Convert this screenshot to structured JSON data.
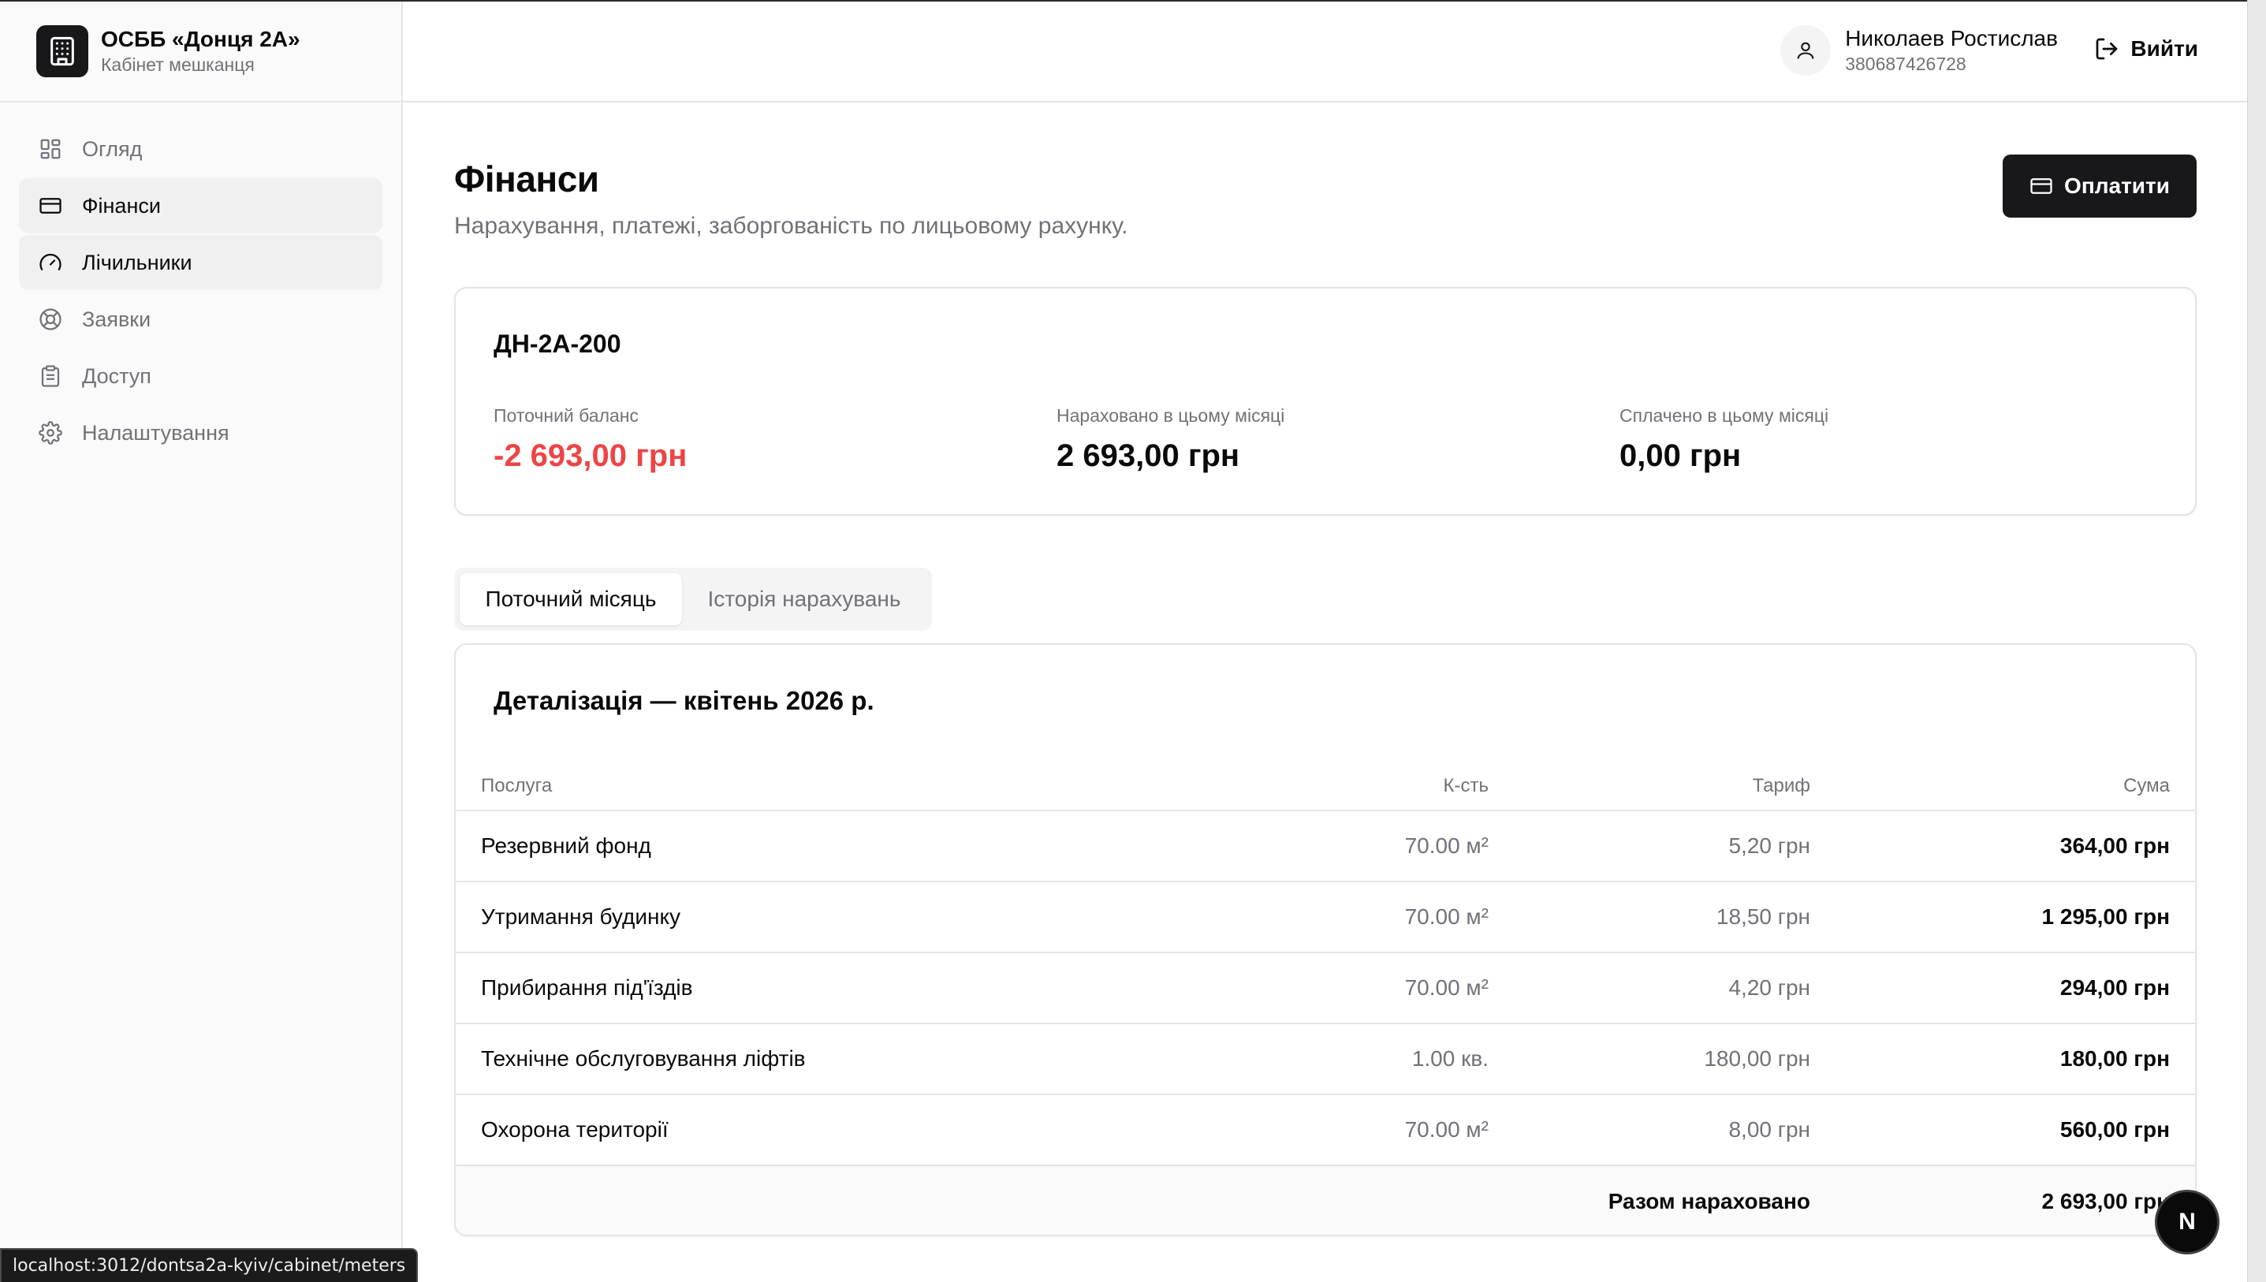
{
  "brand": {
    "title": "ОСББ «Донця 2А»",
    "subtitle": "Кабінет мешканця",
    "icon": "building-icon"
  },
  "sidebar": {
    "items": [
      {
        "label": "Огляд",
        "icon": "dashboard-icon",
        "active": false
      },
      {
        "label": "Фінанси",
        "icon": "credit-card-icon",
        "active": true
      },
      {
        "label": "Лічильники",
        "icon": "gauge-icon",
        "active": false,
        "hover": true
      },
      {
        "label": "Заявки",
        "icon": "lifebuoy-icon",
        "active": false
      },
      {
        "label": "Доступ",
        "icon": "clipboard-icon",
        "active": false
      },
      {
        "label": "Налаштування",
        "icon": "gear-icon",
        "active": false
      }
    ]
  },
  "header": {
    "user_name": "Николаев Ростислав",
    "user_phone": "380687426728",
    "logout_label": "Вийти"
  },
  "page": {
    "title": "Фінанси",
    "subtitle": "Нарахування, платежі, заборгованість по лицьовому рахунку.",
    "pay_label": "Оплатити"
  },
  "summary": {
    "account": "ДН-2А-200",
    "balance_label": "Поточний баланс",
    "balance_value": "-2 693,00 грн",
    "charged_label": "Нараховано в цьому місяці",
    "charged_value": "2 693,00 грн",
    "paid_label": "Сплачено в цьому місяці",
    "paid_value": "0,00 грн",
    "negative_color": "#ef4444"
  },
  "tabs": [
    {
      "label": "Поточний місяць",
      "active": true
    },
    {
      "label": "Історія нарахувань",
      "active": false
    }
  ],
  "detail": {
    "title": "Деталізація — квітень 2026 р.",
    "columns": [
      "Послуга",
      "К-сть",
      "Тариф",
      "Сума"
    ],
    "rows": [
      [
        "Резервний фонд",
        "70.00 м²",
        "5,20 грн",
        "364,00 грн"
      ],
      [
        "Утримання будинку",
        "70.00 м²",
        "18,50 грн",
        "1 295,00 грн"
      ],
      [
        "Прибирання під'їздів",
        "70.00 м²",
        "4,20 грн",
        "294,00 грн"
      ],
      [
        "Технічне обслуговування ліфтів",
        "1.00 кв.",
        "180,00 грн",
        "180,00 грн"
      ],
      [
        "Охорона території",
        "70.00 м²",
        "8,00 грн",
        "560,00 грн"
      ]
    ],
    "total_label": "Разом нараховано",
    "total_value": "2 693,00 грн"
  },
  "status_url": "localhost:3012/dontsa2a-kyiv/cabinet/meters",
  "badge_letter": "N"
}
